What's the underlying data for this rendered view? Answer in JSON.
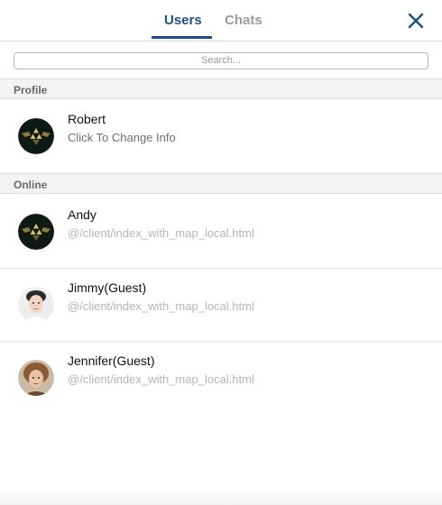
{
  "tabs": {
    "users": "Users",
    "chats": "Chats"
  },
  "search": {
    "placeholder": "Search..."
  },
  "sections": {
    "profile": "Profile",
    "online": "Online"
  },
  "profile": {
    "name": "Robert",
    "subtitle": "Click To Change Info",
    "avatar": "triforce-emblem"
  },
  "online_users": [
    {
      "name": "Andy",
      "location": "@/client/index_with_map_local.html",
      "avatar": "triforce-emblem"
    },
    {
      "name": "Jimmy(Guest)",
      "location": "@/client/index_with_map_local.html",
      "avatar": "guest-photo"
    },
    {
      "name": "Jennifer(Guest)",
      "location": "@/client/index_with_map_local.html",
      "avatar": "guest-photo"
    }
  ],
  "colors": {
    "accent": "#1b4f86",
    "inactive_tab": "#9b9b9b",
    "section_bg": "#f3f3f3",
    "muted_text": "#b5b5b5"
  },
  "icons": {
    "close": "close-icon"
  }
}
